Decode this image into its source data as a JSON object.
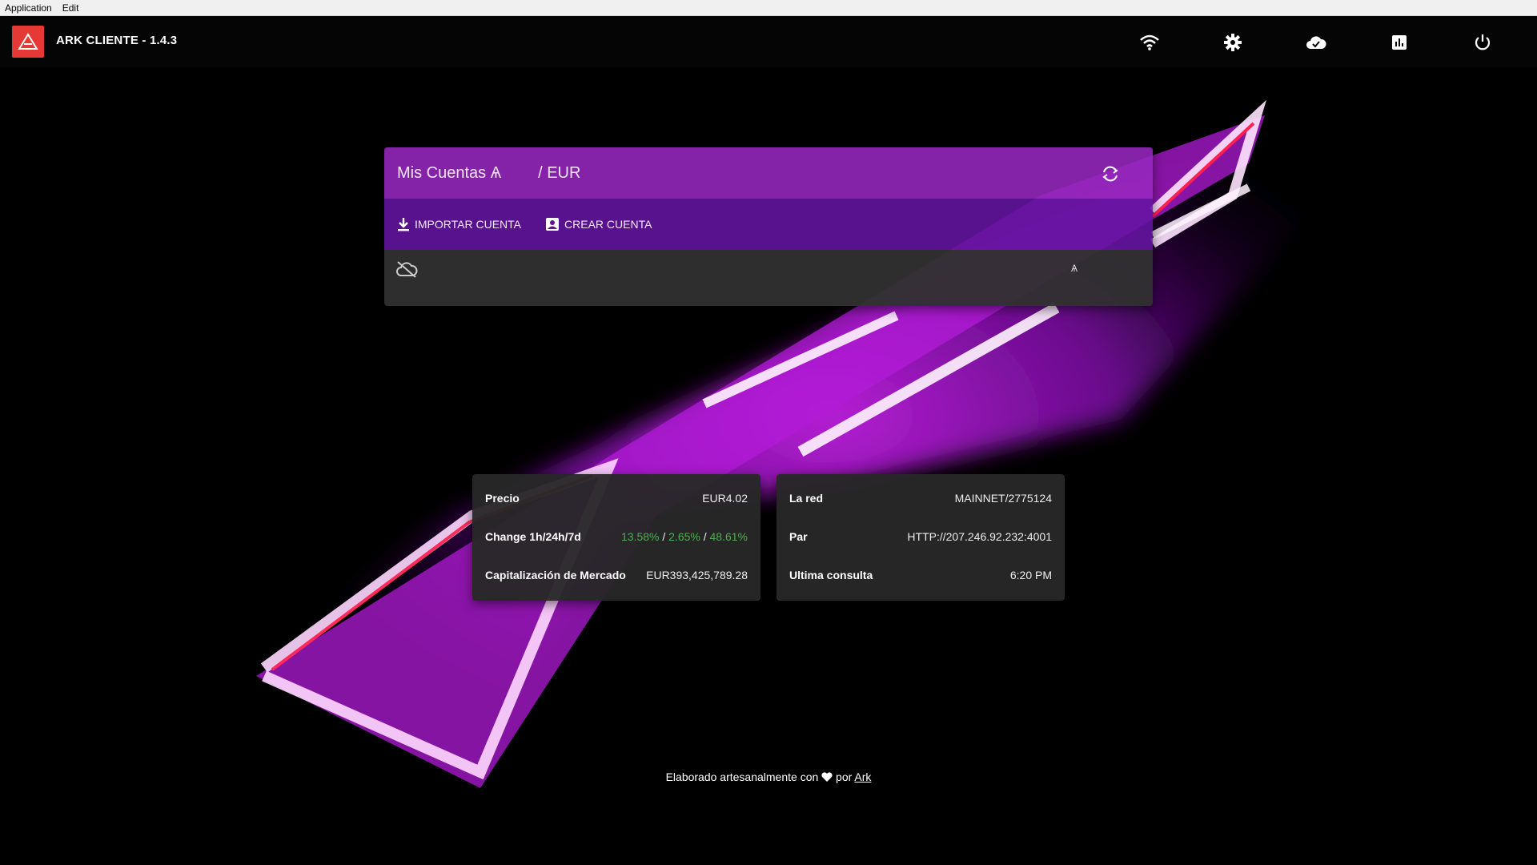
{
  "menubar": {
    "items": [
      "Application",
      "Edit"
    ]
  },
  "toolbar": {
    "title": "ARK CLIENTE - 1.4.3",
    "icons": [
      "wifi-icon",
      "settings-icon",
      "cloud-done-icon",
      "chart-icon",
      "power-icon"
    ]
  },
  "accounts": {
    "title": "Mis Cuentas Ѧ",
    "currency": "/ EUR",
    "import_label": "IMPORTAR CUENTA",
    "create_label": "CREAR CUENTA",
    "symbol": "Ѧ"
  },
  "market": {
    "price_label": "Precio",
    "price_value": "EUR4.02",
    "change_label": "Change 1h/24h/7d",
    "change_1h": "13.58%",
    "change_24h": "2.65%",
    "change_7d": "48.61%",
    "sep": "/",
    "cap_label": "Capitalización de Mercado",
    "cap_value": "EUR393,425,789.28"
  },
  "network": {
    "net_label": "La red",
    "net_value": "MAINNET/2775124",
    "peer_label": "Par",
    "peer_value": "HTTP://207.246.92.232:4001",
    "last_label": "Ultima consulta",
    "last_value": "6:20 PM"
  },
  "footer": {
    "prefix": "Elaborado artesanalmente con",
    "middle": "por",
    "link": "Ark"
  },
  "colors": {
    "accent_red": "#e53935",
    "header_purple": "#9628be",
    "actions_purple": "#6414a0",
    "positive_green": "#4caf50"
  }
}
